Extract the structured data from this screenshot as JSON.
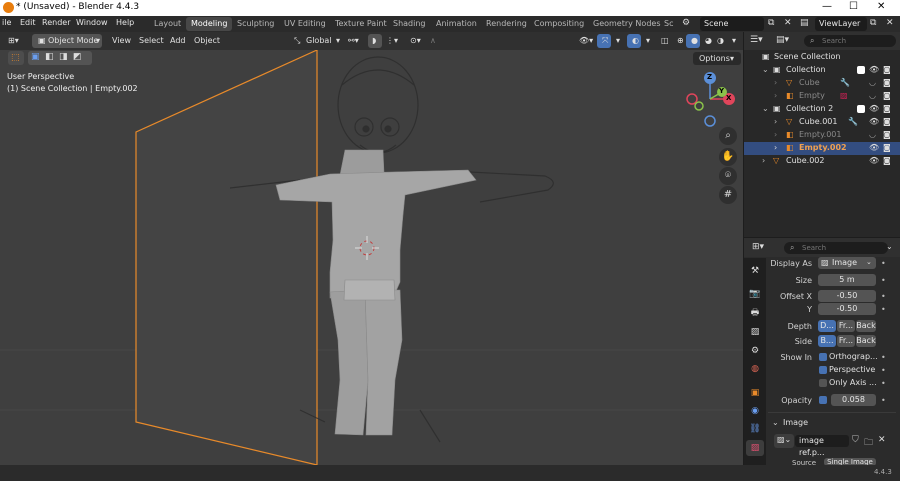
{
  "window": {
    "title": "* (Unsaved) - Blender 4.4.3"
  },
  "menu": [
    "ile",
    "Edit",
    "Render",
    "Window",
    "Help"
  ],
  "workspaces": [
    "Layout",
    "Modeling",
    "Sculpting",
    "UV Editing",
    "Texture Paint",
    "Shading",
    "Animation",
    "Rendering",
    "Compositing",
    "Geometry Nodes",
    "Sc"
  ],
  "active_workspace": "Modeling",
  "scene": "Scene",
  "view_layer": "ViewLayer",
  "viewport": {
    "mode": "Object Mode",
    "menus": [
      "View",
      "Select",
      "Add",
      "Object"
    ],
    "orientation": "Global",
    "options": "Options",
    "overlay_text": [
      "User Perspective",
      "(1) Scene Collection | Empty.002"
    ],
    "gizmo_axes": {
      "z": "Z",
      "x": "X",
      "y": "Y"
    }
  },
  "outliner": {
    "search_placeholder": "Search",
    "rows": [
      {
        "label": "Scene Collection"
      },
      {
        "label": "Collection"
      },
      {
        "label": "Cube"
      },
      {
        "label": "Empty"
      },
      {
        "label": "Collection 2"
      },
      {
        "label": "Cube.001"
      },
      {
        "label": "Empty.001"
      },
      {
        "label": "Empty.002"
      },
      {
        "label": "Cube.002"
      }
    ]
  },
  "properties": {
    "search_placeholder": "Search",
    "display_as_label": "Display As",
    "display_as_value": "Image",
    "size_label": "Size",
    "size_value": "5 m",
    "offset_x_label": "Offset X",
    "offset_x_value": "-0.50",
    "offset_y_label": "Y",
    "offset_y_value": "-0.50",
    "depth_label": "Depth",
    "depth_options": [
      "D...",
      "Fr...",
      "Back"
    ],
    "side_label": "Side",
    "side_options": [
      "B...",
      "Fr...",
      "Back"
    ],
    "show_in_label": "Show In",
    "show_in_options": [
      "Orthograp...",
      "Perspective",
      "Only Axis ..."
    ],
    "opacity_label": "Opacity",
    "opacity_value": "0.058",
    "image_section": "Image",
    "image_name": "image ref.p...",
    "source_label": "Source",
    "source_value": "Single Image"
  },
  "status": {
    "version": "4.4.3"
  }
}
